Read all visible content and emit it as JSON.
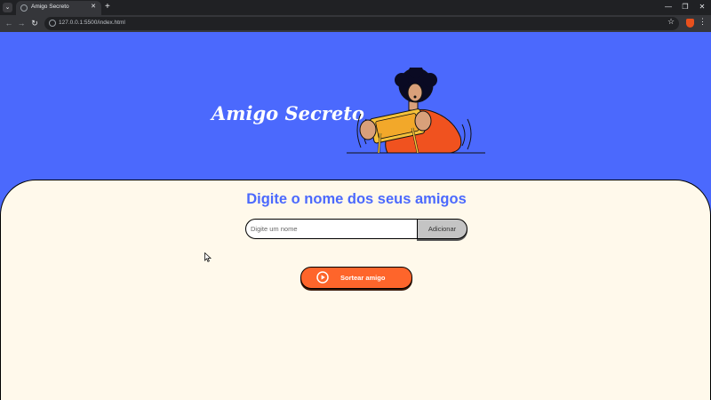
{
  "browser": {
    "tab_title": "Amigo Secreto",
    "tab_close": "✕",
    "new_tab": "+",
    "url": "127.0.0.1:5500/index.html",
    "controls": {
      "minimize": "—",
      "maximize": "❐",
      "close": "✕"
    },
    "nav": {
      "back": "←",
      "forward": "→",
      "reload": "↻"
    },
    "bookmark": "☆",
    "menu": "⋮",
    "tab_search": "⌄"
  },
  "header": {
    "title": "Amigo Secreto",
    "illustration": "person-holding-phone-illustration"
  },
  "main": {
    "section_title": "Digite o nome dos seus amigos",
    "name_input": {
      "value": "",
      "placeholder": "Digite um nome"
    },
    "add_button": "Adicionar",
    "draw_button": "Sortear amigo",
    "draw_icon": "play-circle-icon"
  },
  "colors": {
    "hero_background": "#4b69fd",
    "card_background": "#fff9eb",
    "title_color": "#4b69fd",
    "draw_button": "#fe652b",
    "add_button": "#c4c4c4"
  }
}
